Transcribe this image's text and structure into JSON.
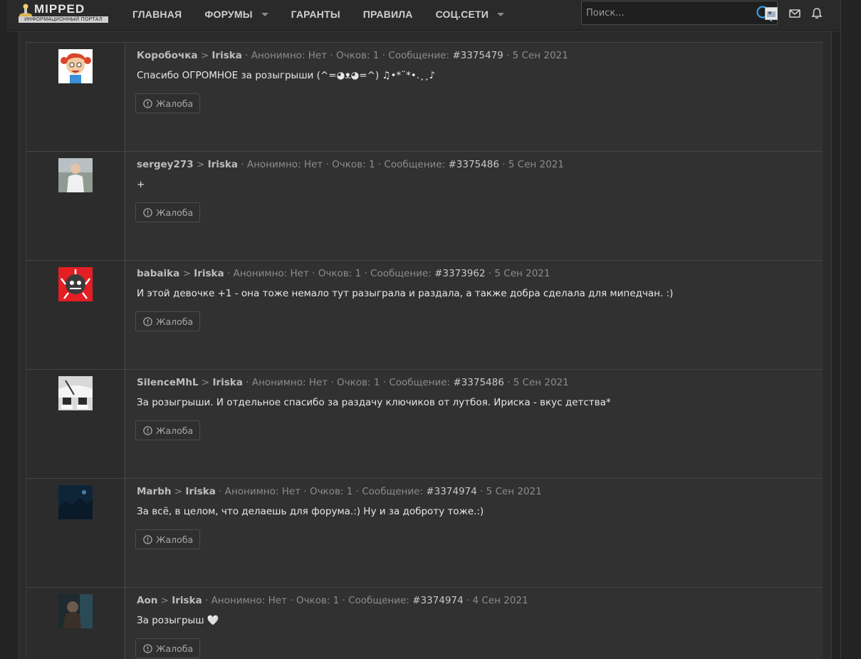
{
  "header": {
    "logo_name": "MIPPED",
    "logo_sub": "ИНФОРМАЦИОННЫЙ ПОРТАЛ",
    "nav": [
      {
        "label": "ГЛАВНАЯ",
        "has_caret": false
      },
      {
        "label": "ФОРУМЫ",
        "has_caret": true
      },
      {
        "label": "ГАРАНТЫ",
        "has_caret": false
      },
      {
        "label": "ПРАВИЛА",
        "has_caret": false
      },
      {
        "label": "СОЦ.СЕТИ",
        "has_caret": true
      }
    ],
    "search_placeholder": "Поиск..."
  },
  "labels": {
    "separator": ">",
    "anon_label": "Анонимно:",
    "points_label": "Очков:",
    "message_label": "Сообщение:",
    "report": "Жалоба"
  },
  "posts": [
    {
      "author": "Коробочка",
      "target": "Iriska",
      "anon": "Нет",
      "points": "1",
      "message_id": "#3375479",
      "date": "5 Сен 2021",
      "text": "Спасибо ОГРОМНОЕ за розыгрыши (^=◕ᴥ◕=^) ♫•*¨*•.¸¸♪",
      "avatar": "cartoon-girl"
    },
    {
      "author": "sergey273",
      "target": "Iriska",
      "anon": "Нет",
      "points": "1",
      "message_id": "#3375486",
      "date": "5 Сен 2021",
      "text": "+",
      "avatar": "man-photo"
    },
    {
      "author": "babaika",
      "target": "Iriska",
      "anon": "Нет",
      "points": "1",
      "message_id": "#3373962",
      "date": "5 Сен 2021",
      "text": "И этой девочке +1 - она тоже немало тут разыграла и раздала, а также добра сделала для мипедчан. :)",
      "avatar": "red-art"
    },
    {
      "author": "SilenceMhL",
      "target": "Iriska",
      "anon": "Нет",
      "points": "1",
      "message_id": "#3375486",
      "date": "5 Сен 2021",
      "text": "За розыгрыши. И отдельное спасибо за раздачу ключиков от лутбоя. Ириска - вкус детства*",
      "avatar": "sneakers"
    },
    {
      "author": "Marbh",
      "target": "Iriska",
      "anon": "Нет",
      "points": "1",
      "message_id": "#3374974",
      "date": "5 Сен 2021",
      "text": "За всё, в целом, что делаешь для форума.:) Ну и за доброту тоже.:)",
      "avatar": "blue-night"
    },
    {
      "author": "Aon",
      "target": "Iriska",
      "anon": "Нет",
      "points": "1",
      "message_id": "#3374974",
      "date": "4 Сен 2021",
      "text": "За розыгрыш 🤍",
      "avatar": "dark-figure"
    }
  ],
  "colors": {
    "background": "#232323",
    "post": "#313131",
    "accent_search": "#3aa0e0"
  }
}
